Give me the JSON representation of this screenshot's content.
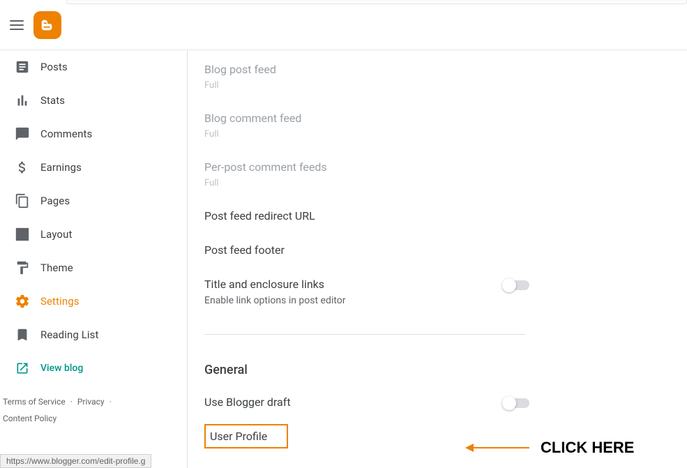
{
  "sidebar": {
    "items": [
      {
        "label": "Posts"
      },
      {
        "label": "Stats"
      },
      {
        "label": "Comments"
      },
      {
        "label": "Earnings"
      },
      {
        "label": "Pages"
      },
      {
        "label": "Layout"
      },
      {
        "label": "Theme"
      },
      {
        "label": "Settings"
      },
      {
        "label": "Reading List"
      }
    ],
    "view_blog": "View blog",
    "footer": {
      "terms": "Terms of Service",
      "privacy": "Privacy",
      "content_policy": "Content Policy"
    }
  },
  "main": {
    "feed_blocks": [
      {
        "label": "Blog post feed",
        "value": "Full"
      },
      {
        "label": "Blog comment feed",
        "value": "Full"
      },
      {
        "label": "Per-post comment feeds",
        "value": "Full"
      }
    ],
    "post_feed_redirect": "Post feed redirect URL",
    "post_feed_footer": "Post feed footer",
    "title_enclosure": {
      "label": "Title and enclosure links",
      "sub": "Enable link options in post editor"
    },
    "general_heading": "General",
    "use_blogger_draft": "Use Blogger draft",
    "user_profile": "User Profile"
  },
  "annotation": {
    "text": "CLICK HERE"
  },
  "status_url": "https://www.blogger.com/edit-profile.g"
}
